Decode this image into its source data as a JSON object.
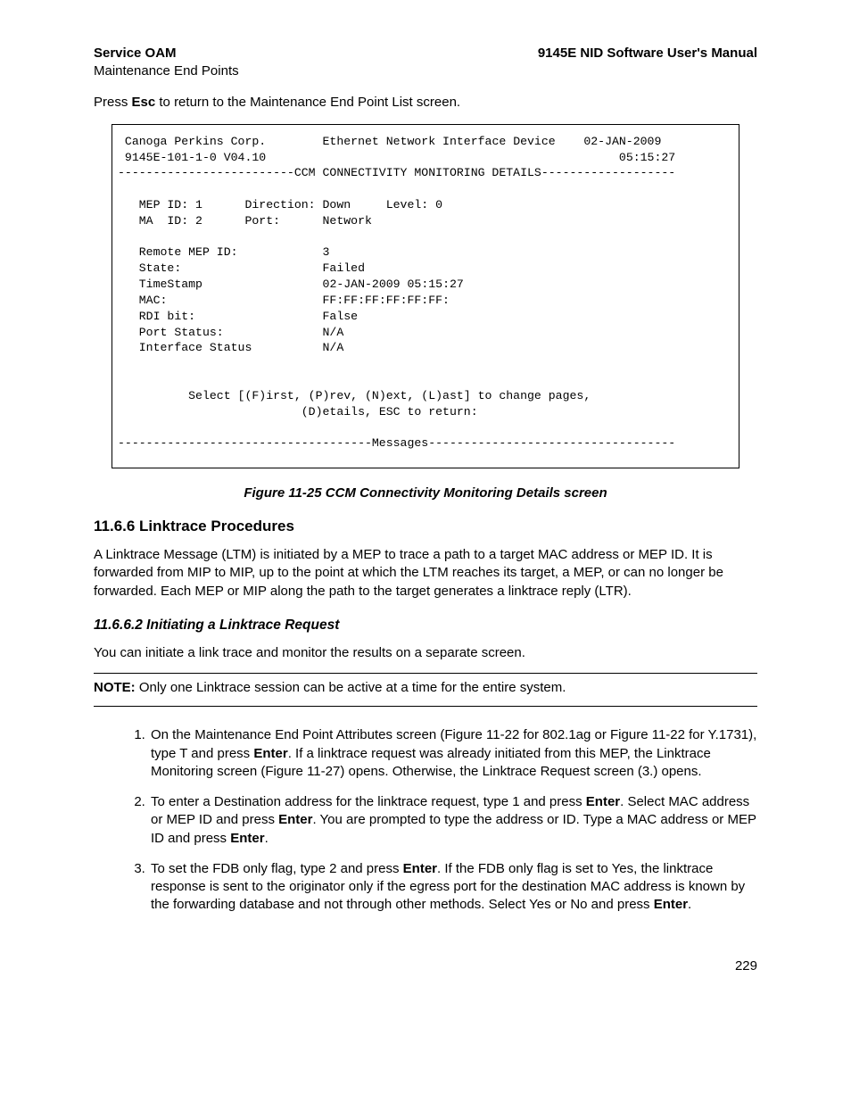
{
  "header": {
    "left": "Service OAM",
    "right": "9145E NID Software User's Manual",
    "sub": "Maintenance End Points"
  },
  "intro": {
    "pre": "Press ",
    "key": "Esc",
    "post": " to return to the Maintenance End Point List screen."
  },
  "terminal": {
    "corp": "Canoga Perkins Corp.",
    "device": "Ethernet Network Interface Device",
    "date": "02-JAN-2009",
    "model": "9145E-101-1-0 V04.10",
    "time": "05:15:27",
    "title_bar": "-------------------------CCM CONNECTIVITY MONITORING DETAILS-------------------",
    "row1": "   MEP ID: 1      Direction: Down     Level: 0",
    "row2": "   MA  ID: 2      Port:      Network",
    "fields": {
      "remote_label": "Remote MEP ID:",
      "remote_val": "3",
      "state_label": "State:",
      "state_val": "Failed",
      "ts_label": "TimeStamp",
      "ts_val": "02-JAN-2009 05:15:27",
      "mac_label": "MAC:",
      "mac_val": "FF:FF:FF:FF:FF:FF:",
      "rdi_label": "RDI bit:",
      "rdi_val": "False",
      "ps_label": "Port Status:",
      "ps_val": "N/A",
      "is_label": "Interface Status",
      "is_val": "N/A"
    },
    "nav1": "Select [(F)irst, (P)rev, (N)ext, (L)ast] to change pages,",
    "nav2": "(D)etails, ESC to return:",
    "msgbar": "------------------------------------Messages-----------------------------------"
  },
  "figure_caption": "Figure 11-25  CCM Connectivity Monitoring Details screen",
  "section": {
    "num_title": "11.6.6  Linktrace Procedures",
    "para": "A Linktrace Message (LTM) is initiated by a MEP to trace a path to a target MAC address or MEP ID. It is forwarded from MIP to MIP, up to the point at which the LTM reaches its target, a MEP, or can no longer be forwarded. Each MEP or MIP along the path to the target generates a linktrace reply (LTR)."
  },
  "subsection": {
    "num_title": "11.6.6.2 Initiating a Linktrace Request",
    "para": "You can initiate a link trace and monitor the results on a separate screen."
  },
  "note": {
    "label": "NOTE:",
    "text": " Only one Linktrace session can be active at a time for the entire system."
  },
  "steps": {
    "s1a": "On the Maintenance End Point Attributes screen (Figure 11-22 for 802.1ag or Figure 11-22 for Y.1731), type T and press ",
    "s1b": ". If a linktrace request was already initiated from this MEP, the Linktrace Monitoring screen (Figure 11-27) opens. Otherwise, the Linktrace Request screen (3.) opens.",
    "s2a": "To enter a Destination address for the linktrace request, type 1 and press ",
    "s2b": ". Select MAC address or MEP ID and press ",
    "s2c": ". You are prompted to type the address or ID. Type a MAC address or MEP ID and press ",
    "s2d": ".",
    "s3a": "To set the FDB only flag, type 2 and press ",
    "s3b": ". If the FDB only flag is set to Yes, the linktrace response is sent to the originator only if the egress port for the destination MAC address is known by the forwarding database and not through other methods. Select Yes or No and press ",
    "s3c": ".",
    "enter": "Enter"
  },
  "page_number": "229"
}
